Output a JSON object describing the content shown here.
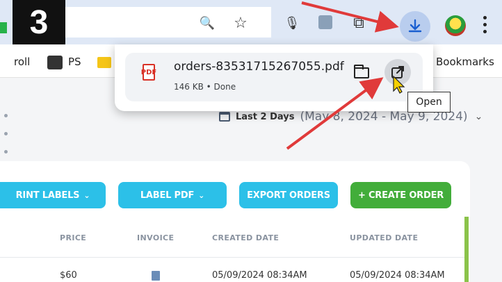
{
  "step_badge": "3",
  "bookmarks": {
    "items": [
      {
        "label": "roll"
      },
      {
        "label": "PS"
      },
      {
        "label": "Bookmarks"
      }
    ]
  },
  "download": {
    "filename": "orders-83531715267055.pdf",
    "status": "146 KB • Done",
    "open_tooltip": "Open",
    "pdf_badge": "PDF"
  },
  "toolbar": {
    "search_glyph": "🔍",
    "star_glyph": "☆",
    "mic_glyph": "🎙",
    "ext_glyph": "⧉"
  },
  "date_filter": {
    "label": "Last 2 Days",
    "range": "(May 8, 2024 - May 9, 2024)",
    "chevron": "⌄"
  },
  "actions": {
    "print_labels": "RINT LABELS",
    "label_pdf": "LABEL PDF",
    "export_orders": "EXPORT ORDERS",
    "create_order": "+ CREATE ORDER",
    "caret": "⌄"
  },
  "table": {
    "columns": [
      "PRICE",
      "INVOICE",
      "CREATED DATE",
      "UPDATED DATE"
    ],
    "rows": [
      {
        "price": "$60",
        "created": "05/09/2024 08:34AM",
        "updated": "05/09/2024 08:34AM"
      }
    ]
  },
  "colors": {
    "annotation_red": "#e03a3a",
    "button_blue": "#2cc0e8",
    "button_green": "#42ad3a"
  }
}
